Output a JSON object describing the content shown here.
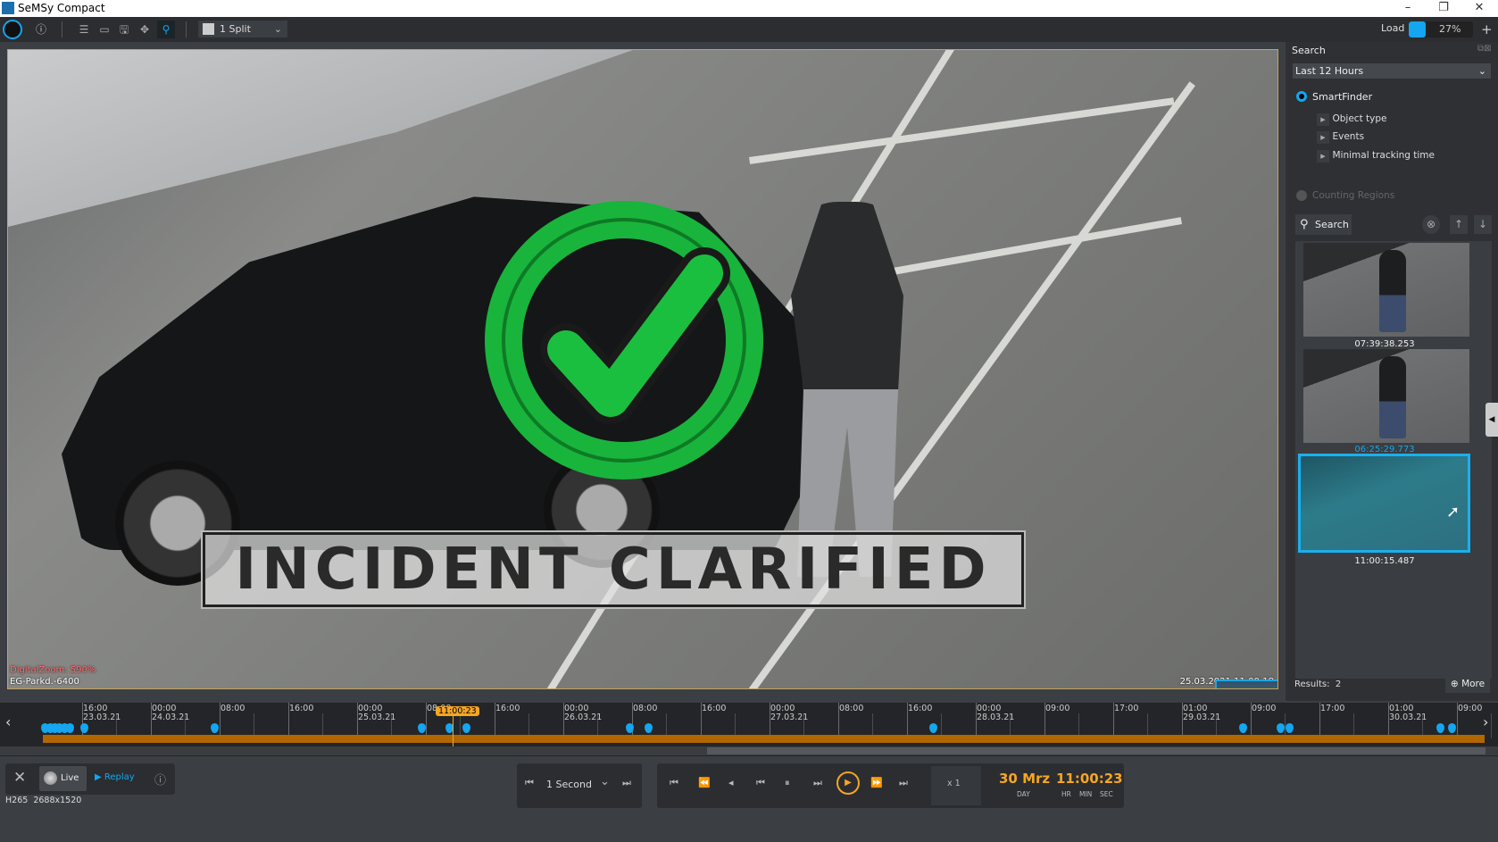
{
  "window": {
    "title": "SeMSy Compact",
    "controls": [
      "minimize",
      "restore",
      "close"
    ]
  },
  "toolbar": {
    "icons": [
      "logo-eye-icon",
      "info-icon",
      "tree-icon",
      "sequence-icon",
      "save-icon",
      "ptz-icon",
      "search-icon"
    ],
    "split_label": "1 Split",
    "load_label": "Load",
    "load_value": "27%",
    "load_percent": 27,
    "add": "+"
  },
  "video": {
    "overlay_title": "INCIDENT CLARIFIED",
    "digital_zoom": "DigitalZoom: 590%",
    "camera_name": "EG-Parkd.-6400",
    "timestamp": "25.03.2021 11:00:18"
  },
  "search": {
    "title": "Search",
    "range": "Last 12 Hours",
    "smartfinder": "SmartFinder",
    "filters": [
      "Object type",
      "Events",
      "Minimal tracking time"
    ],
    "counting_regions": "Counting Regions",
    "search_button": "Search",
    "thumbnails": [
      {
        "time": "07:39:38.253"
      },
      {
        "time": "06:25:29.773"
      },
      {
        "time": "11:00:15.487",
        "selected": true
      }
    ],
    "results_label": "Results:",
    "results_count": "2",
    "more_button": "More"
  },
  "timeline": {
    "labels": [
      [
        "16:00",
        "23.03.21"
      ],
      [
        "00:00",
        "24.03.21"
      ],
      [
        "08:00",
        ""
      ],
      [
        "16:00",
        ""
      ],
      [
        "00:00",
        "25.03.21"
      ],
      [
        "08:00",
        ""
      ],
      [
        "16:00",
        ""
      ],
      [
        "00:00",
        "26.03.21"
      ],
      [
        "08:00",
        ""
      ],
      [
        "16:00",
        ""
      ],
      [
        "00:00",
        "27.03.21"
      ],
      [
        "08:00",
        ""
      ],
      [
        "16:00",
        ""
      ],
      [
        "00:00",
        "28.03.21"
      ],
      [
        "09:00",
        ""
      ],
      [
        "17:00",
        ""
      ],
      [
        "01:00",
        "29.03.21"
      ],
      [
        "09:00",
        ""
      ],
      [
        "17:00",
        ""
      ],
      [
        "01:00",
        "30.03.21"
      ],
      [
        "09:00",
        ""
      ]
    ],
    "current": "11:00:23",
    "colors": {
      "recording": "#b06700",
      "event": "#14a6f0",
      "cursor": "#f5a623"
    }
  },
  "controls": {
    "live": "Live",
    "replay": "Replay",
    "step": "1 Second",
    "speed": "x 1",
    "day": "30 Mrz",
    "time": "11:00:23",
    "day_label": "DAY",
    "hr": "HR",
    "min": "MIN",
    "sec": "SEC",
    "codec": "H265",
    "resolution": "2688x1520"
  }
}
